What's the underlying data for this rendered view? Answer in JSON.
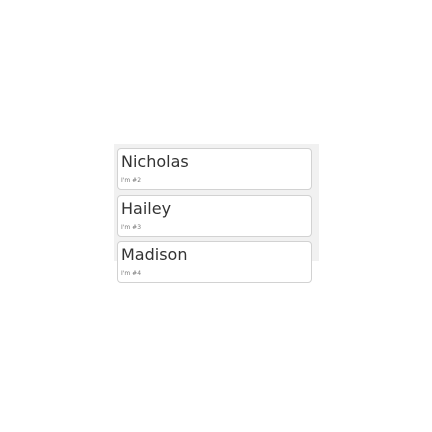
{
  "list": {
    "items": [
      {
        "name": "Nicholas",
        "subtitle": "I'm #2"
      },
      {
        "name": "Hailey",
        "subtitle": "I'm #3"
      },
      {
        "name": "Madison",
        "subtitle": "I'm #4"
      }
    ]
  }
}
